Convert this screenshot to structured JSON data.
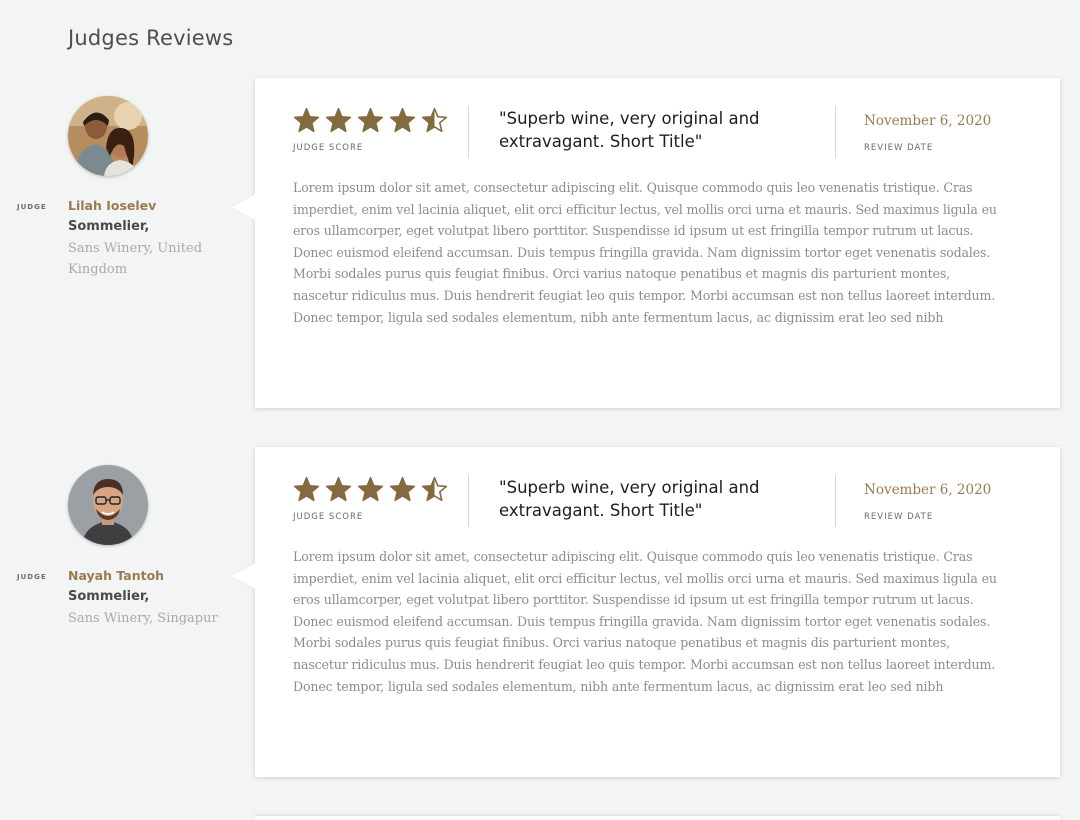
{
  "section": {
    "title": "Judges Reviews"
  },
  "colors": {
    "accent": "#9a7b4f",
    "star": "#85693f"
  },
  "reviews": [
    {
      "judge": {
        "tag": "JUDGE",
        "name": "Lilah Ioselev",
        "role": "Sommelier,",
        "org": "Sans Winery, United Kingdom",
        "avatar_icon": "couple-avatar"
      },
      "score": {
        "value": 4.5,
        "max": 5,
        "label": "JUDGE SCORE"
      },
      "title": "\"Superb wine, very original and extravagant. Short Title\"",
      "date": "November 6, 2020",
      "date_label": "REVIEW DATE",
      "body": "Lorem ipsum dolor sit amet, consectetur adipiscing elit. Quisque commodo quis leo venenatis tristique. Cras imperdiet, enim vel lacinia aliquet, elit orci efficitur lectus, vel mollis orci urna et mauris. Sed maximus ligula eu eros ullamcorper, eget volutpat libero porttitor. Suspendisse id ipsum ut est fringilla tempor rutrum ut lacus. Donec euismod eleifend accumsan. Duis tempus fringilla gravida. Nam dignissim tortor eget venenatis sodales. Morbi sodales purus quis feugiat finibus. Orci varius natoque penatibus et magnis dis parturient montes, nascetur ridiculus mus. Duis hendrerit feugiat leo quis tempor. Morbi accumsan est non tellus laoreet interdum. Donec tempor, ligula sed sodales elementum, nibh ante fermentum lacus, ac dignissim erat leo sed nibh"
    },
    {
      "judge": {
        "tag": "JUDGE",
        "name": "Nayah Tantoh",
        "role": "Sommelier,",
        "org": "Sans Winery, Singapur",
        "avatar_icon": "man-glasses-avatar"
      },
      "score": {
        "value": 4.5,
        "max": 5,
        "label": "JUDGE SCORE"
      },
      "title": "\"Superb wine, very original and extravagant. Short Title\"",
      "date": "November 6, 2020",
      "date_label": "REVIEW DATE",
      "body": "Lorem ipsum dolor sit amet, consectetur adipiscing elit. Quisque commodo quis leo venenatis tristique. Cras imperdiet, enim vel lacinia aliquet, elit orci efficitur lectus, vel mollis orci urna et mauris. Sed maximus ligula eu eros ullamcorper, eget volutpat libero porttitor. Suspendisse id ipsum ut est fringilla tempor rutrum ut lacus. Donec euismod eleifend accumsan. Duis tempus fringilla gravida. Nam dignissim tortor eget venenatis sodales. Morbi sodales purus quis feugiat finibus. Orci varius natoque penatibus et magnis dis parturient montes, nascetur ridiculus mus. Duis hendrerit feugiat leo quis tempor. Morbi accumsan est non tellus laoreet interdum. Donec tempor, ligula sed sodales elementum, nibh ante fermentum lacus, ac dignissim erat leo sed nibh"
    }
  ]
}
